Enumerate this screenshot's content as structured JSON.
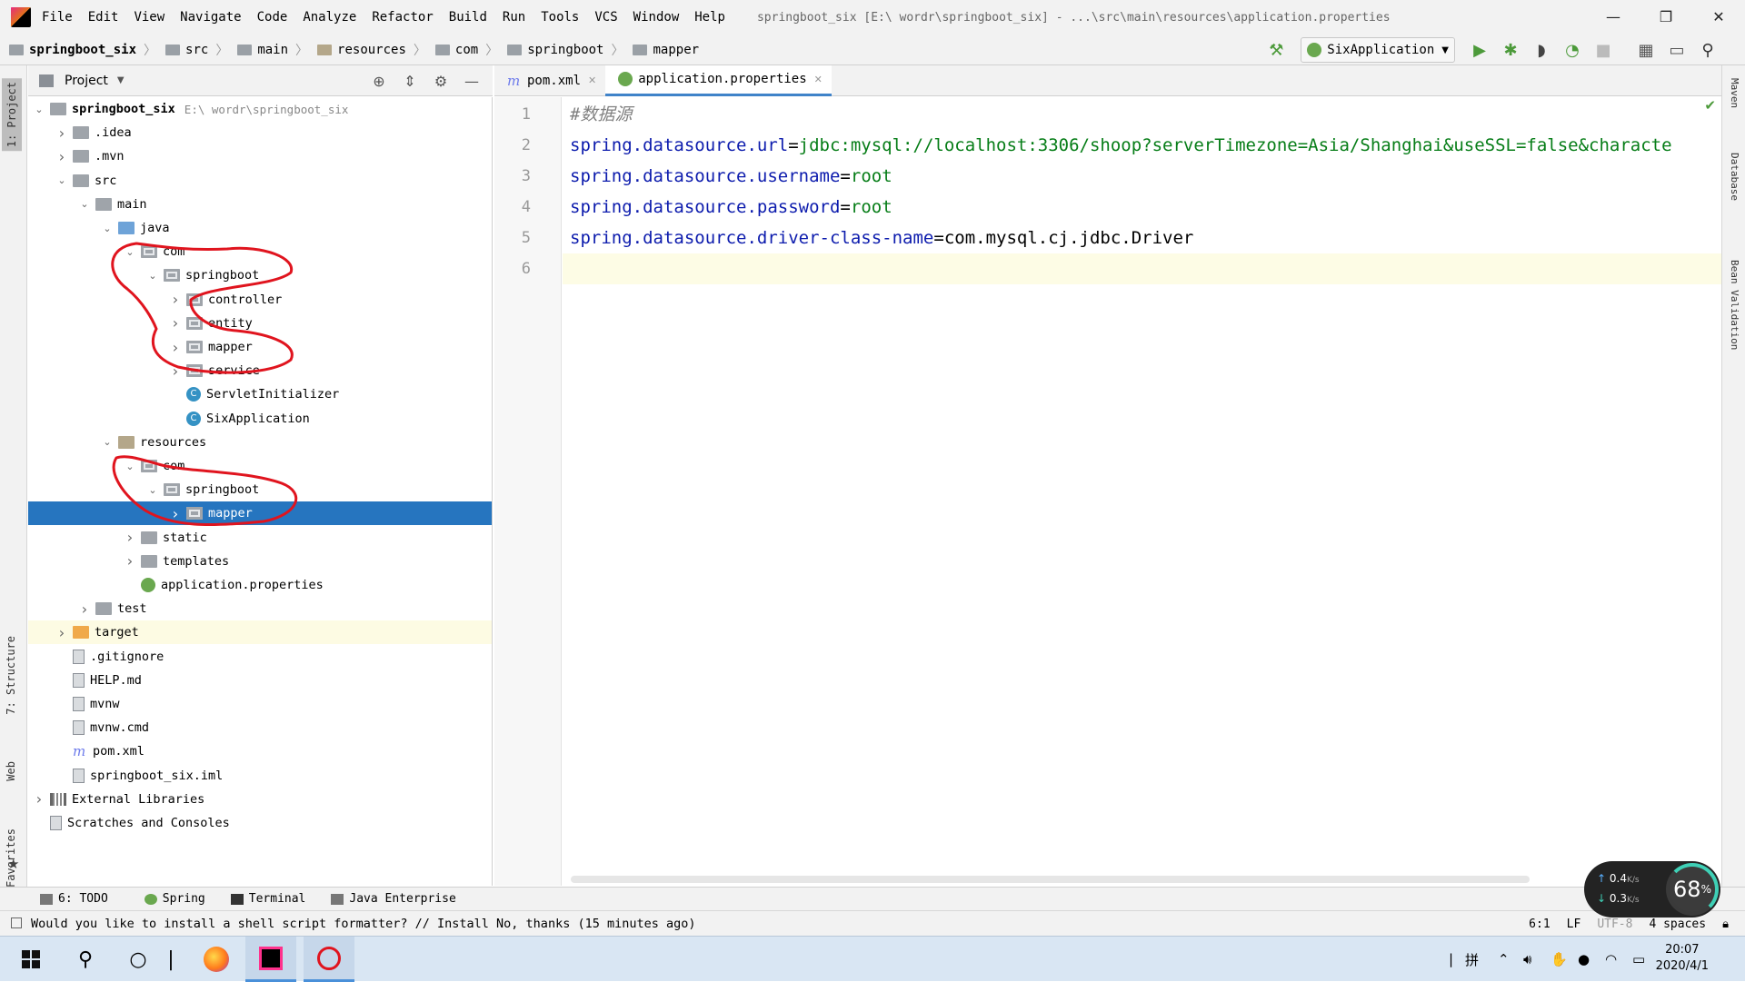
{
  "menubar": {
    "items": [
      "File",
      "Edit",
      "View",
      "Navigate",
      "Code",
      "Analyze",
      "Refactor",
      "Build",
      "Run",
      "Tools",
      "VCS",
      "Window",
      "Help"
    ],
    "title": "springboot_six [E:\\ wordr\\springboot_six] - ...\\src\\main\\resources\\application.properties",
    "window_controls": [
      "—",
      "❐",
      "✕"
    ]
  },
  "breadcrumbs": [
    "springboot_six",
    "src",
    "main",
    "resources",
    "com",
    "springboot",
    "mapper"
  ],
  "run_config": {
    "label": "SixApplication"
  },
  "left_tabs": {
    "project": "1: Project",
    "structure": "7: Structure",
    "web": "Web",
    "favorites": "2: Favorites"
  },
  "right_tabs": {
    "maven": "Maven",
    "database": "Database",
    "bean_validation": "Bean Validation"
  },
  "project_panel": {
    "title": "Project",
    "tree": [
      {
        "label": "springboot_six",
        "path": "E:\\ wordr\\springboot_six",
        "depth": 0,
        "arrow": "down",
        "icon": "folder",
        "bold": true
      },
      {
        "label": ".idea",
        "depth": 1,
        "arrow": "right",
        "icon": "folder"
      },
      {
        "label": ".mvn",
        "depth": 1,
        "arrow": "right",
        "icon": "folder"
      },
      {
        "label": "src",
        "depth": 1,
        "arrow": "down",
        "icon": "folder"
      },
      {
        "label": "main",
        "depth": 2,
        "arrow": "down",
        "icon": "folder"
      },
      {
        "label": "java",
        "depth": 3,
        "arrow": "down",
        "icon": "src"
      },
      {
        "label": "com",
        "depth": 4,
        "arrow": "down",
        "icon": "pkg"
      },
      {
        "label": "springboot",
        "depth": 5,
        "arrow": "down",
        "icon": "pkg"
      },
      {
        "label": "controller",
        "depth": 6,
        "arrow": "right",
        "icon": "pkg"
      },
      {
        "label": "entity",
        "depth": 6,
        "arrow": "right",
        "icon": "pkg"
      },
      {
        "label": "mapper",
        "depth": 6,
        "arrow": "right",
        "icon": "pkg"
      },
      {
        "label": "service",
        "depth": 6,
        "arrow": "right",
        "icon": "pkg"
      },
      {
        "label": "ServletInitializer",
        "depth": 6,
        "arrow": "",
        "icon": "cls"
      },
      {
        "label": "SixApplication",
        "depth": 6,
        "arrow": "",
        "icon": "cls"
      },
      {
        "label": "resources",
        "depth": 3,
        "arrow": "down",
        "icon": "res"
      },
      {
        "label": "com",
        "depth": 4,
        "arrow": "down",
        "icon": "pkg"
      },
      {
        "label": "springboot",
        "depth": 5,
        "arrow": "down",
        "icon": "pkg"
      },
      {
        "label": "mapper",
        "depth": 6,
        "arrow": "right",
        "icon": "pkg",
        "selected": true
      },
      {
        "label": "static",
        "depth": 4,
        "arrow": "right",
        "icon": "folder"
      },
      {
        "label": "templates",
        "depth": 4,
        "arrow": "right",
        "icon": "folder"
      },
      {
        "label": "application.properties",
        "depth": 4,
        "arrow": "",
        "icon": "leaf"
      },
      {
        "label": "test",
        "depth": 2,
        "arrow": "right",
        "icon": "folder"
      },
      {
        "label": "target",
        "depth": 1,
        "arrow": "right",
        "icon": "tgt",
        "highlight": true
      },
      {
        "label": ".gitignore",
        "depth": 1,
        "arrow": "",
        "icon": "file"
      },
      {
        "label": "HELP.md",
        "depth": 1,
        "arrow": "",
        "icon": "file"
      },
      {
        "label": "mvnw",
        "depth": 1,
        "arrow": "",
        "icon": "file"
      },
      {
        "label": "mvnw.cmd",
        "depth": 1,
        "arrow": "",
        "icon": "file"
      },
      {
        "label": "pom.xml",
        "depth": 1,
        "arrow": "",
        "icon": "mvn"
      },
      {
        "label": "springboot_six.iml",
        "depth": 1,
        "arrow": "",
        "icon": "file"
      },
      {
        "label": "External Libraries",
        "depth": 0,
        "arrow": "right",
        "icon": "lib"
      },
      {
        "label": "Scratches and Consoles",
        "depth": 0,
        "arrow": "",
        "icon": "file"
      }
    ]
  },
  "editor": {
    "tabs": [
      {
        "label": "pom.xml",
        "active": false,
        "icon": "mvn"
      },
      {
        "label": "application.properties",
        "active": true,
        "icon": "leaf"
      }
    ],
    "lines": [
      {
        "n": "1",
        "parts": [
          {
            "t": "#数据源",
            "c": "cm"
          }
        ]
      },
      {
        "n": "2",
        "parts": [
          {
            "t": "spring.datasource.url",
            "c": "k"
          },
          {
            "t": "=",
            "c": "d"
          },
          {
            "t": "jdbc:mysql://localhost:3306/shoop?serverTimezone=Asia/Shanghai&useSSL=false&characte",
            "c": "v"
          }
        ]
      },
      {
        "n": "3",
        "parts": [
          {
            "t": "spring.datasource.username",
            "c": "k"
          },
          {
            "t": "=",
            "c": "d"
          },
          {
            "t": "root",
            "c": "v"
          }
        ]
      },
      {
        "n": "4",
        "parts": [
          {
            "t": "spring.datasource.password",
            "c": "k"
          },
          {
            "t": "=",
            "c": "d"
          },
          {
            "t": "root",
            "c": "v"
          }
        ]
      },
      {
        "n": "5",
        "parts": [
          {
            "t": "spring.datasource.driver-class-name",
            "c": "k"
          },
          {
            "t": "=",
            "c": "d"
          },
          {
            "t": "com.mysql.cj.jdbc.Driver",
            "c": "d"
          }
        ]
      },
      {
        "n": "6",
        "parts": [],
        "current": true
      }
    ]
  },
  "bottom_tabs": [
    "6: TODO",
    "Spring",
    "Terminal",
    "Java Enterprise"
  ],
  "status": {
    "message": "Would you like to install a shell script formatter? // Install   No, thanks (15 minutes ago)",
    "position": "6:1",
    "line_sep": "LF",
    "encoding": "UTF-8",
    "indent": "4 spaces"
  },
  "net_widget": {
    "up": "0.4",
    "down": "0.3",
    "unit": "K/s",
    "percent": "68",
    "pct_sign": "%"
  },
  "taskbar": {
    "ime": "拼",
    "time": "20:07",
    "date": "2020/4/1"
  },
  "colors": {
    "selection": "#2675bf",
    "annotation": "#e0141e",
    "accent": "#4083c9"
  }
}
